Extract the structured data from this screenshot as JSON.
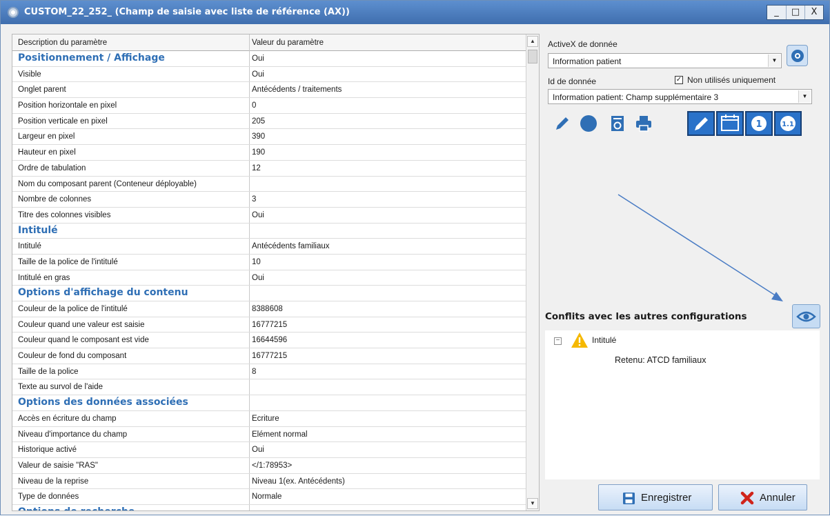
{
  "window": {
    "title": "CUSTOM_22_252_ (Champ de saisie avec liste de référence (AX))",
    "controls": [
      "_",
      "□",
      "X"
    ]
  },
  "grid": {
    "col_description": "Description du paramètre",
    "col_value": "Valeur du paramètre",
    "rows": [
      {
        "type": "section",
        "label": "Positionnement / Affichage",
        "value": "Oui"
      },
      {
        "type": "row",
        "label": "Visible",
        "value": "Oui"
      },
      {
        "type": "row",
        "label": "Onglet parent",
        "value": "Antécédents / traitements"
      },
      {
        "type": "row",
        "label": "Position horizontale en pixel",
        "value": "0"
      },
      {
        "type": "row",
        "label": "Position verticale en pixel",
        "value": "205"
      },
      {
        "type": "row",
        "label": "Largeur en pixel",
        "value": "390"
      },
      {
        "type": "row",
        "label": "Hauteur en pixel",
        "value": "190"
      },
      {
        "type": "row",
        "label": "Ordre de tabulation",
        "value": "12"
      },
      {
        "type": "row",
        "label": "Nom du composant parent (Conteneur déployable)",
        "value": ""
      },
      {
        "type": "row",
        "label": "Nombre de colonnes",
        "value": "3"
      },
      {
        "type": "row",
        "label": "Titre des colonnes visibles",
        "value": "Oui"
      },
      {
        "type": "section",
        "label": "Intitulé",
        "value": ""
      },
      {
        "type": "row",
        "label": "Intitulé",
        "value": "Antécédents familiaux"
      },
      {
        "type": "row",
        "label": "Taille de la police de l'intitulé",
        "value": "10"
      },
      {
        "type": "row",
        "label": "Intitulé en gras",
        "value": "Oui"
      },
      {
        "type": "section",
        "label": "Options d'affichage du contenu",
        "value": ""
      },
      {
        "type": "row",
        "label": "Couleur de la police de l'intitulé",
        "value": "8388608"
      },
      {
        "type": "row",
        "label": "Couleur quand une valeur est saisie",
        "value": "16777215"
      },
      {
        "type": "row",
        "label": "Couleur quand le composant est vide",
        "value": "16644596"
      },
      {
        "type": "row",
        "label": "Couleur de fond du composant",
        "value": "16777215"
      },
      {
        "type": "row",
        "label": "Taille de la police",
        "value": "8"
      },
      {
        "type": "row",
        "label": "Texte au survol de l'aide",
        "value": ""
      },
      {
        "type": "section",
        "label": "Options des données associées",
        "value": ""
      },
      {
        "type": "row",
        "label": "Accès en écriture du champ",
        "value": "Ecriture"
      },
      {
        "type": "row",
        "label": "Niveau d'importance du champ",
        "value": "Elément normal"
      },
      {
        "type": "row",
        "label": "Historique activé",
        "value": "Oui"
      },
      {
        "type": "row",
        "label": "Valeur de saisie \"RAS\"",
        "value": "</1:78953>"
      },
      {
        "type": "row",
        "label": "Niveau de la reprise",
        "value": "Niveau 1(ex. Antécédents)"
      },
      {
        "type": "row",
        "label": "Type de données",
        "value": "Normale"
      },
      {
        "type": "section",
        "label": "Options de recherche",
        "value": ""
      }
    ]
  },
  "right": {
    "activex_label": "ActiveX de donnée",
    "activex_value": "Information patient",
    "id_label": "Id de donnée",
    "unused_only_label": "Non utilisés uniquement",
    "unused_only_checked": true,
    "id_value": "Information patient: Champ supplémentaire 3",
    "toolbar_icons": [
      "pencil-icon",
      "circle-icon",
      "refresh-document-icon",
      "printer-icon"
    ],
    "toggle_icons": [
      "pencil-icon",
      "calendar-icon",
      "number-one-icon",
      "decimal-icon"
    ],
    "toggle_labels": [
      "1",
      "1.1"
    ],
    "conflicts_title": "Conflits avec les autres configurations",
    "tree_node": "Intitulé",
    "tree_detail": "Retenu: ATCD familiaux"
  },
  "actions": {
    "save": "Enregistrer",
    "cancel": "Annuler"
  },
  "colors": {
    "title_bar": "#4a7cbf",
    "section_text": "#2f6fb5",
    "toggle_button": "#2a72c9",
    "cancel_x": "#d0241b",
    "warning": "#f5b800"
  }
}
